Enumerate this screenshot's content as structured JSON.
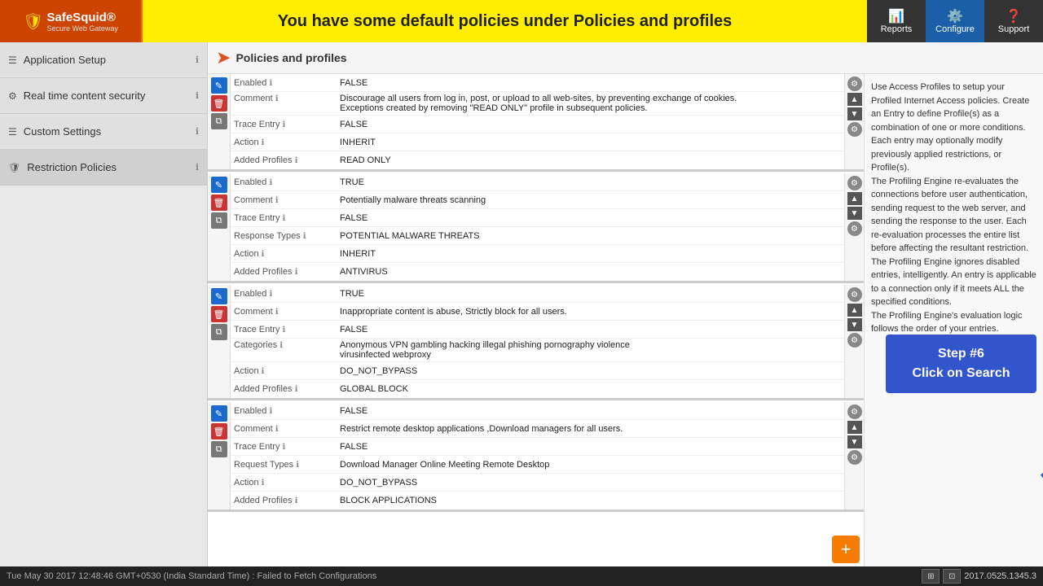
{
  "header": {
    "logo_name": "SafeSquid®",
    "logo_sub": "Secure Web Gateway",
    "banner": "You have some default policies under Policies and profiles",
    "nav": [
      {
        "label": "Reports",
        "icon": "📊",
        "active": false
      },
      {
        "label": "Configure",
        "icon": "⚙️",
        "active": true
      },
      {
        "label": "Support",
        "icon": "❓",
        "active": false
      }
    ]
  },
  "sidebar": {
    "items": [
      {
        "label": "Application Setup",
        "icon": "☰",
        "active": false
      },
      {
        "label": "Real time content security",
        "icon": "⚙️",
        "active": false
      },
      {
        "label": "Custom Settings",
        "icon": "☰",
        "active": false
      },
      {
        "label": "Restriction Policies",
        "icon": "🛡",
        "active": true
      }
    ]
  },
  "policies_header": "Policies and profiles",
  "policies": [
    {
      "fields": [
        {
          "label": "Enabled",
          "value": "FALSE"
        },
        {
          "label": "Comment",
          "value": "Discourage all users from log in, post, or upload to all web-sites, by preventing exchange of cookies.\nExceptions created by removing \"READ ONLY\" profile in subsequent policies."
        },
        {
          "label": "Trace Entry",
          "value": "FALSE"
        },
        {
          "label": "Action",
          "value": "INHERIT"
        },
        {
          "label": "Added Profiles",
          "value": "READ ONLY"
        }
      ]
    },
    {
      "fields": [
        {
          "label": "Enabled",
          "value": "TRUE"
        },
        {
          "label": "Comment",
          "value": "Potentially malware threats scanning"
        },
        {
          "label": "Trace Entry",
          "value": "FALSE"
        },
        {
          "label": "Response Types",
          "value": "POTENTIAL MALWARE THREATS"
        },
        {
          "label": "Action",
          "value": "INHERIT"
        },
        {
          "label": "Added Profiles",
          "value": "ANTIVIRUS"
        }
      ]
    },
    {
      "fields": [
        {
          "label": "Enabled",
          "value": "TRUE"
        },
        {
          "label": "Comment",
          "value": "Inappropriate content is abuse, Strictly block for all users."
        },
        {
          "label": "Trace Entry",
          "value": "FALSE"
        },
        {
          "label": "Categories",
          "value": "Anonymous VPN  gambling  hacking  illegal  phishing  pornography  violence\nvirusinfected  webproxy"
        },
        {
          "label": "Action",
          "value": "DO_NOT_BYPASS"
        },
        {
          "label": "Added Profiles",
          "value": "GLOBAL BLOCK"
        }
      ]
    },
    {
      "fields": [
        {
          "label": "Enabled",
          "value": "FALSE"
        },
        {
          "label": "Comment",
          "value": "Restrict remote desktop applications ,Download managers for all users."
        },
        {
          "label": "Trace Entry",
          "value": "FALSE"
        },
        {
          "label": "Request Types",
          "value": "Download Manager  Online Meeting  Remote Desktop"
        },
        {
          "label": "Action",
          "value": "DO_NOT_BYPASS"
        },
        {
          "label": "Added Profiles",
          "value": "BLOCK APPLICATIONS"
        }
      ]
    }
  ],
  "right_panel": [
    "Use Access Profiles to setup your Profiled Internet Access policies. Create an Entry to define Profile(s) as a combination of one or more conditions. Each entry may optionally modify previously applied restrictions, or Profile(s).",
    "The Profiling Engine re-evaluates the connections before user authentication, sending request to the web server, and sending the response to the user. Each re-evaluation processes the entire list before affecting the resultant restriction.",
    "The Profiling Engine ignores disabled entries, intelligently. An entry is applicable to a connection only if it meets ALL the specified conditions.",
    "The Profiling Engine's evaluation logic follows the order of your entries."
  ],
  "tooltip": {
    "line1": "Step #6",
    "line2": "Click on Search"
  },
  "statusbar": {
    "left": "Tue May 30 2017 12:48:46 GMT+0530 (India Standard Time) : Failed to Fetch Configurations",
    "right": "2017.0525.1345.3"
  }
}
